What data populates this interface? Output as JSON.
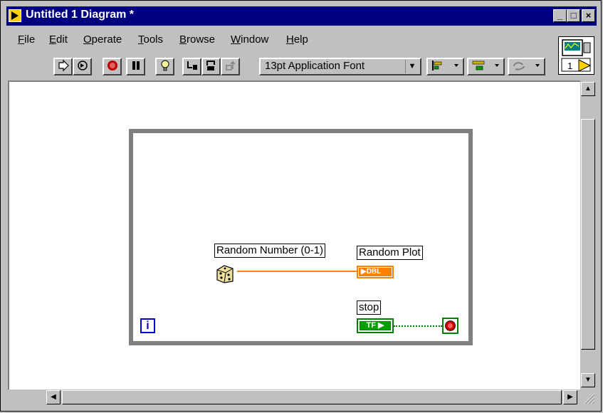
{
  "window": {
    "title": "Untitled 1 Diagram *",
    "controls": {
      "minimize": "_",
      "maximize": "□",
      "close": "×"
    }
  },
  "menu": {
    "items": [
      {
        "label": "File",
        "u": "F",
        "rest": "ile"
      },
      {
        "label": "Edit",
        "u": "E",
        "rest": "dit"
      },
      {
        "label": "Operate",
        "u": "O",
        "rest": "perate"
      },
      {
        "label": "Tools",
        "u": "T",
        "rest": "ools"
      },
      {
        "label": "Browse",
        "u": "B",
        "rest": "rowse"
      },
      {
        "label": "Window",
        "u": "W",
        "rest": "indow"
      },
      {
        "label": "Help",
        "u": "H",
        "rest": "elp"
      }
    ]
  },
  "toolbar": {
    "font_selector": "13pt Application Font",
    "icons": [
      "run-icon",
      "run-continuously-icon",
      "abort-icon",
      "pause-icon",
      "highlight-execution-icon",
      "step-into-icon",
      "step-over-icon",
      "step-out-icon",
      "align-objects-icon",
      "distribute-objects-icon",
      "reorder-icon"
    ]
  },
  "connector_pane": {
    "number": "1"
  },
  "diagram": {
    "while_loop": {
      "iteration_terminal": "i"
    },
    "nodes": {
      "random_number_label": "Random Number (0-1)",
      "random_plot_label": "Random Plot",
      "random_plot_type": "DBL",
      "stop_label": "stop",
      "stop_type": "TF"
    },
    "wire_colors": {
      "numeric": "#ff8000",
      "boolean": "#008000"
    }
  }
}
